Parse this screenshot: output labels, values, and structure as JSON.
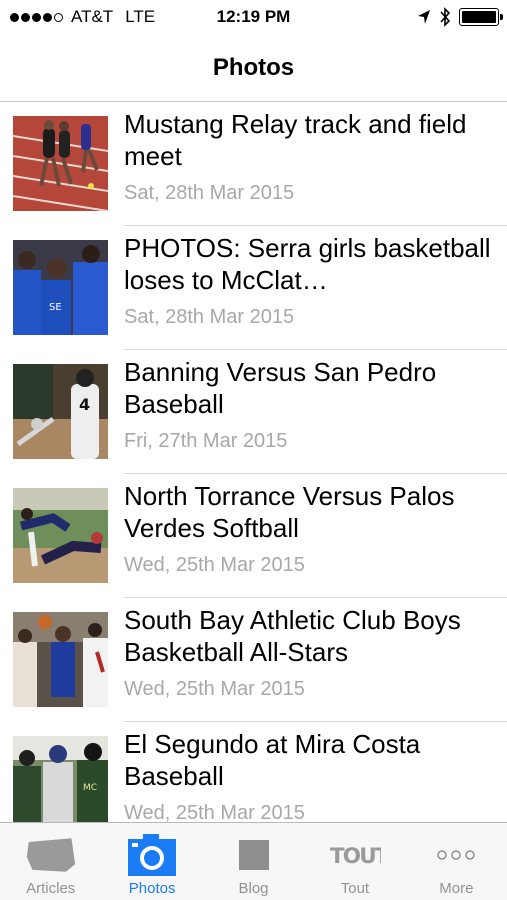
{
  "status_bar": {
    "carrier": "AT&T",
    "network": "LTE",
    "time": "12:19 PM",
    "signal_bars": 4,
    "signal_total": 5
  },
  "nav": {
    "title": "Photos"
  },
  "items": [
    {
      "title": "Mustang Relay track and field meet",
      "date": "Sat, 28th Mar 2015",
      "thumb": "track-photo"
    },
    {
      "title": "PHOTOS: Serra girls basketball loses to McClat…",
      "date": "Sat, 28th Mar 2015",
      "thumb": "basketball-girls-photo"
    },
    {
      "title": "Banning Versus San Pedro Baseball",
      "date": "Fri, 27th Mar 2015",
      "thumb": "baseball-photo"
    },
    {
      "title": "North Torrance Versus Palos Verdes Softball",
      "date": "Wed, 25th Mar 2015",
      "thumb": "softball-photo"
    },
    {
      "title": "South Bay Athletic Club Boys Basketball All-Stars",
      "date": "Wed, 25th Mar 2015",
      "thumb": "basketball-boys-photo"
    },
    {
      "title": "El Segundo at Mira Costa Baseball",
      "date": "Wed, 25th Mar 2015",
      "thumb": "baseball-team-photo"
    }
  ],
  "tabs": [
    {
      "label": "Articles",
      "icon": "newspaper-icon",
      "active": false
    },
    {
      "label": "Photos",
      "icon": "camera-icon",
      "active": true
    },
    {
      "label": "Blog",
      "icon": "blog-icon",
      "active": false
    },
    {
      "label": "Tout",
      "icon": "tout-icon",
      "active": false
    },
    {
      "label": "More",
      "icon": "more-icon",
      "active": false
    }
  ],
  "colors": {
    "accent": "#1a7cf4",
    "inactive": "#929292",
    "date": "#a8a8a8"
  }
}
